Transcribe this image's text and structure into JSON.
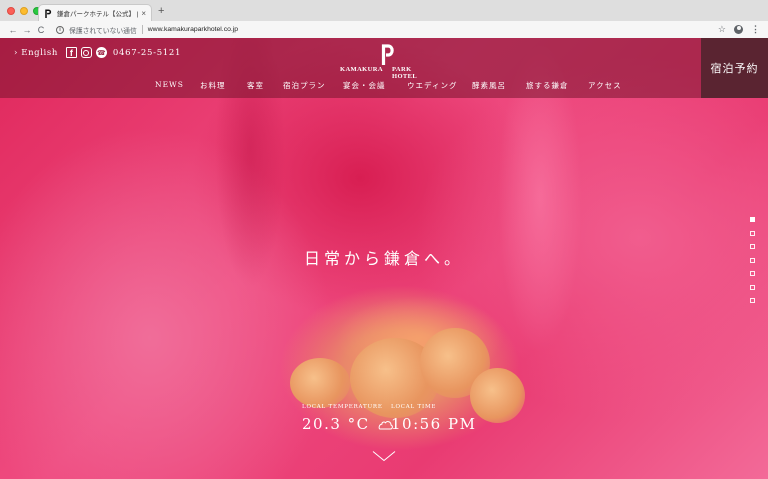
{
  "browser": {
    "tab_title": "鎌倉パークホテル【公式】 | KA",
    "tab_close": "×",
    "new_tab": "+",
    "security_label": "保護されていない通信",
    "url": "www.kamakuraparkhotel.co.jp",
    "back": "←",
    "forward": "→",
    "reload": "C",
    "info_glyph": "i",
    "star_glyph": "☆",
    "menu_glyph": "⋮"
  },
  "header": {
    "english_link": "› English",
    "phone": "0467-25-5121",
    "logo_left": "KAMAKURA",
    "logo_right": "PARK HOTEL",
    "facebook_glyph": "f",
    "phone_glyph": "☎",
    "nav": [
      "NEWS",
      "お料理",
      "客室",
      "宿泊プラン",
      "宴会・会議",
      "ウエディング",
      "酵素風呂",
      "旅する鎌倉",
      "アクセス"
    ],
    "reserve": "宿泊予約"
  },
  "hero": {
    "tagline": "日常から鎌倉へ。",
    "slide_count": 7,
    "active_slide": 1
  },
  "info": {
    "temp_label": "LOCAL TEMPERATURE",
    "temp_value": "20.3 °C",
    "time_label": "LOCAL TIME",
    "time_value": "10:56 PM"
  },
  "colors": {
    "header_overlay": "#78142d",
    "reserve_bg": "#5a2431",
    "hero_pink": "#e93b72"
  }
}
